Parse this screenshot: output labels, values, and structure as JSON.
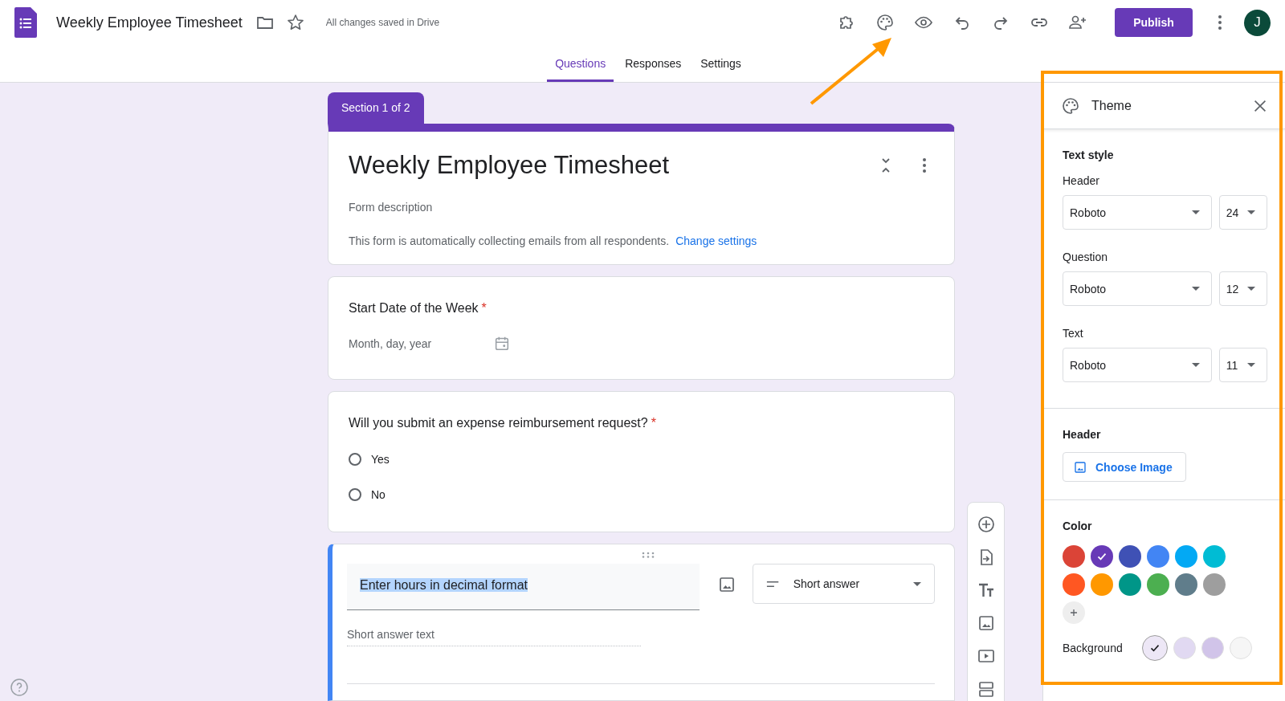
{
  "app": {
    "title": "Weekly Employee Timesheet",
    "save_status": "All changes saved in Drive",
    "publish": "Publish",
    "avatar": "J"
  },
  "tabs": [
    {
      "label": "Questions",
      "selected": true
    },
    {
      "label": "Responses",
      "selected": false
    },
    {
      "label": "Settings",
      "selected": false
    }
  ],
  "section_tab": "Section 1 of 2",
  "form_header": {
    "title": "Weekly Employee Timesheet",
    "description_placeholder": "Form description",
    "notice": "This form is automatically collecting emails from all respondents.",
    "notice_link": "Change settings"
  },
  "questions": [
    {
      "kind": "date",
      "title": "Start Date of the Week",
      "required_mark": "*",
      "placeholder": "Month, day, year"
    },
    {
      "kind": "radio",
      "title": "Will you submit an expense reimbursement request?",
      "required_mark": "*",
      "options": [
        {
          "label": "Yes",
          "selected": false
        },
        {
          "label": "No",
          "selected": false
        }
      ]
    },
    {
      "kind": "editing",
      "title": "Enter hours in decimal format",
      "type_label": "Short answer",
      "answer_placeholder": "Short answer text"
    }
  ],
  "theme": {
    "title": "Theme",
    "text_style_label": "Text style",
    "fonts": [
      {
        "label": "Header",
        "font": "Roboto",
        "size": "24"
      },
      {
        "label": "Question",
        "font": "Roboto",
        "size": "12"
      },
      {
        "label": "Text",
        "font": "Roboto",
        "size": "11"
      }
    ],
    "header_label": "Header",
    "choose_image": "Choose Image",
    "color_label": "Color",
    "colors": [
      {
        "color": "#db4437",
        "selected": false
      },
      {
        "color": "#673ab7",
        "selected": true
      },
      {
        "color": "#3f51b5",
        "selected": false
      },
      {
        "color": "#4285f4",
        "selected": false
      },
      {
        "color": "#03a9f4",
        "selected": false
      },
      {
        "color": "#00bcd4",
        "selected": false
      },
      {
        "color": "#ff5722",
        "selected": false
      },
      {
        "color": "#ff9800",
        "selected": false
      },
      {
        "color": "#009688",
        "selected": false
      },
      {
        "color": "#4caf50",
        "selected": false
      },
      {
        "color": "#607d8b",
        "selected": false
      },
      {
        "color": "#9e9e9e",
        "selected": false
      }
    ],
    "background_label": "Background",
    "backgrounds": [
      {
        "color": "#ede7f6",
        "selected": true
      },
      {
        "color": "#e1d9f2",
        "selected": false
      },
      {
        "color": "#d1c4e9",
        "selected": false
      },
      {
        "color": "#f6f6f6",
        "selected": false
      }
    ]
  }
}
